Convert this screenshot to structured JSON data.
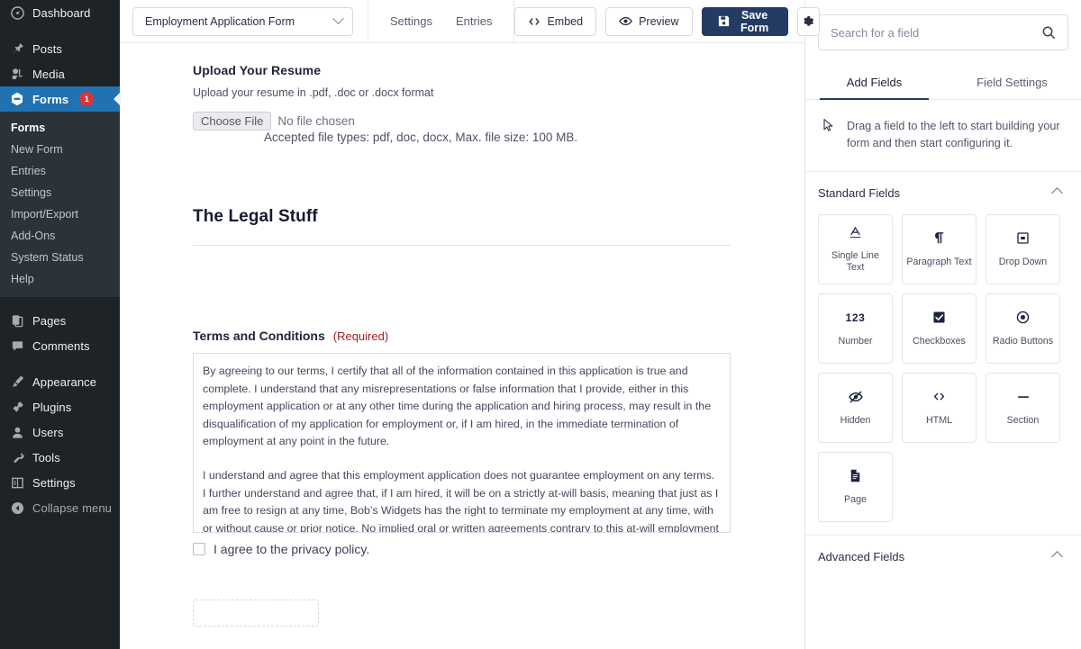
{
  "wp_sidebar": {
    "items": [
      {
        "label": "Dashboard",
        "icon": "dashboard-icon",
        "glyph": "◉",
        "active": false,
        "spaced": false
      },
      {
        "label": "Posts",
        "icon": "pin-icon",
        "glyph": "✎",
        "active": false,
        "spaced": true
      },
      {
        "label": "Media",
        "icon": "media-icon",
        "glyph": "🖼",
        "active": false,
        "spaced": false
      },
      {
        "label": "Forms",
        "icon": "forms-icon",
        "glyph": "⬣",
        "active": true,
        "spaced": false,
        "badge": "1"
      },
      {
        "label": "Pages",
        "icon": "pages-icon",
        "glyph": "▤",
        "active": false,
        "spaced": true
      },
      {
        "label": "Comments",
        "icon": "comments-icon",
        "glyph": "💬",
        "active": false,
        "spaced": false
      },
      {
        "label": "Appearance",
        "icon": "brush-icon",
        "glyph": "🖌",
        "active": false,
        "spaced": true
      },
      {
        "label": "Plugins",
        "icon": "plug-icon",
        "glyph": "🔌",
        "active": false,
        "spaced": false
      },
      {
        "label": "Users",
        "icon": "user-icon",
        "glyph": "👤",
        "active": false,
        "spaced": false
      },
      {
        "label": "Tools",
        "icon": "wrench-icon",
        "glyph": "🔧",
        "active": false,
        "spaced": false
      },
      {
        "label": "Settings",
        "icon": "settings-icon",
        "glyph": "⚙",
        "active": false,
        "spaced": false
      },
      {
        "label": "Collapse menu",
        "icon": "collapse-icon",
        "glyph": "◀",
        "active": false,
        "spaced": false,
        "muted": true
      }
    ],
    "submenu": {
      "items": [
        {
          "label": "Forms",
          "current": true
        },
        {
          "label": "New Form",
          "current": false
        },
        {
          "label": "Entries",
          "current": false
        },
        {
          "label": "Settings",
          "current": false
        },
        {
          "label": "Import/Export",
          "current": false
        },
        {
          "label": "Add-Ons",
          "current": false
        },
        {
          "label": "System Status",
          "current": false
        },
        {
          "label": "Help",
          "current": false
        }
      ]
    }
  },
  "toolbar": {
    "form_name": "Employment Application Form",
    "tabs": [
      {
        "label": "Settings"
      },
      {
        "label": "Entries"
      }
    ],
    "embed_label": "Embed",
    "preview_label": "Preview",
    "save_label": "Save Form",
    "settings_icon_name": "gear-icon"
  },
  "form": {
    "upload": {
      "label": "Upload Your Resume",
      "description": "Upload your resume in .pdf, .doc or .docx format",
      "choose_file_button": "Choose File",
      "no_file_text": "No file chosen",
      "accepted_text": "Accepted file types: pdf, doc, docx, Max. file size: 100 MB."
    },
    "section": {
      "title": "The Legal Stuff"
    },
    "terms": {
      "label": "Terms and Conditions",
      "required_text": "(Required)",
      "paragraphs": [
        "By agreeing to our terms, I certify that all of the information contained in this application is true and complete. I understand that any misrepresentations or false information that I provide, either in this employment application or at any other time during the application and hiring process, may result in the disqualification of my application for employment or, if I am hired, in the immediate termination of employment at any point in the future.",
        "I understand and agree that this employment application does not guarantee employment on any terms. I further understand and agree that, if I am hired, it will be on a strictly at-will basis, meaning that just as I am free to resign at any time, Bob's Widgets has the right to terminate my employment at any time, with or without cause or prior notice. No implied oral or written agreements contrary to this at-will employment basis are valid unless they"
      ]
    },
    "privacy": {
      "label": "I agree to the privacy policy.",
      "checked": false
    }
  },
  "panel": {
    "search": {
      "placeholder": "Search for a field",
      "value": "",
      "icon": "search-icon"
    },
    "tabs": [
      {
        "label": "Add Fields",
        "active": true
      },
      {
        "label": "Field Settings",
        "active": false
      }
    ],
    "drag_hint": "Drag a field to the left to start building your form and then start configuring it.",
    "drag_hint_icon": "cursor-arrow-icon",
    "standard_fields": {
      "title": "Standard Fields",
      "expanded": true,
      "fields": [
        {
          "label": "Single Line Text",
          "icon": "single-line-text-icon",
          "glyph": "A"
        },
        {
          "label": "Paragraph Text",
          "icon": "paragraph-text-icon",
          "glyph": "¶"
        },
        {
          "label": "Drop Down",
          "icon": "drop-down-icon",
          "glyph": "▣"
        },
        {
          "label": "Number",
          "icon": "number-icon",
          "glyph": "123"
        },
        {
          "label": "Checkboxes",
          "icon": "checkbox-icon",
          "glyph": "☑"
        },
        {
          "label": "Radio Buttons",
          "icon": "radio-button-icon",
          "glyph": "◉"
        },
        {
          "label": "Hidden",
          "icon": "hidden-eye-icon",
          "glyph": "👁"
        },
        {
          "label": "HTML",
          "icon": "html-code-icon",
          "glyph": "<>"
        },
        {
          "label": "Section",
          "icon": "section-icon",
          "glyph": "—"
        },
        {
          "label": "Page",
          "icon": "page-icon",
          "glyph": "▤"
        }
      ]
    },
    "advanced_fields": {
      "title": "Advanced Fields",
      "expanded": true
    }
  },
  "colors": {
    "wp_sidebar_bg": "#1d2327",
    "wp_submenu_bg": "#2c3338",
    "wp_active_blue": "#2271b1",
    "wp_badge_red": "#d63638",
    "primary_navy": "#243b63",
    "required_red": "#a02020",
    "text_dark": "#20253a",
    "border_gray": "#e3e4e9"
  }
}
